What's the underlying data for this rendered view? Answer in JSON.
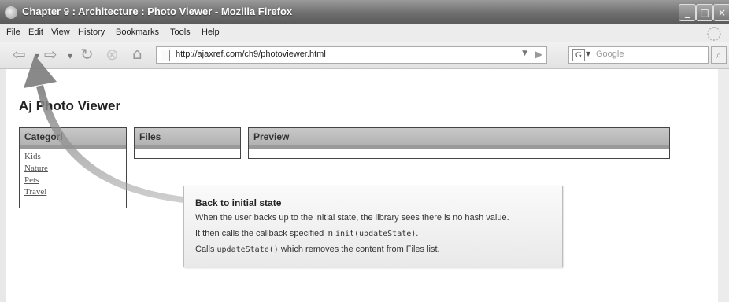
{
  "window": {
    "title": "Chapter 9 : Architecture : Photo Viewer - Mozilla Firefox"
  },
  "menu": [
    "File",
    "Edit",
    "View",
    "History",
    "Bookmarks",
    "Tools",
    "Help"
  ],
  "address": {
    "url": "http://ajaxref.com/ch9/photoviewer.html"
  },
  "search": {
    "placeholder": "Google"
  },
  "page": {
    "title": "Aj   Photo Viewer",
    "categories_header": "Categori",
    "categories": [
      "Kids",
      "Nature",
      "Pets",
      "Travel"
    ],
    "files_header": "Files",
    "preview_header": "Preview"
  },
  "callout": {
    "title": "Back to initial state",
    "line1": "When the user backs up to the initial state, the library sees there is no hash value.",
    "line2_pre": "It then calls the callback specified in ",
    "line2_code": "init(updateState)",
    "line2_post": ".",
    "line3_pre": "Calls ",
    "line3_code": "updateState()",
    "line3_post": " which removes the content from Files list."
  },
  "icons": [
    "firefox-icon",
    "minimize-icon",
    "maximize-icon",
    "close-icon",
    "back-icon",
    "forward-icon",
    "reload-icon",
    "stop-icon",
    "home-icon",
    "page-icon",
    "go-icon",
    "search-engine-icon",
    "magnifier-icon",
    "throbber-icon"
  ]
}
